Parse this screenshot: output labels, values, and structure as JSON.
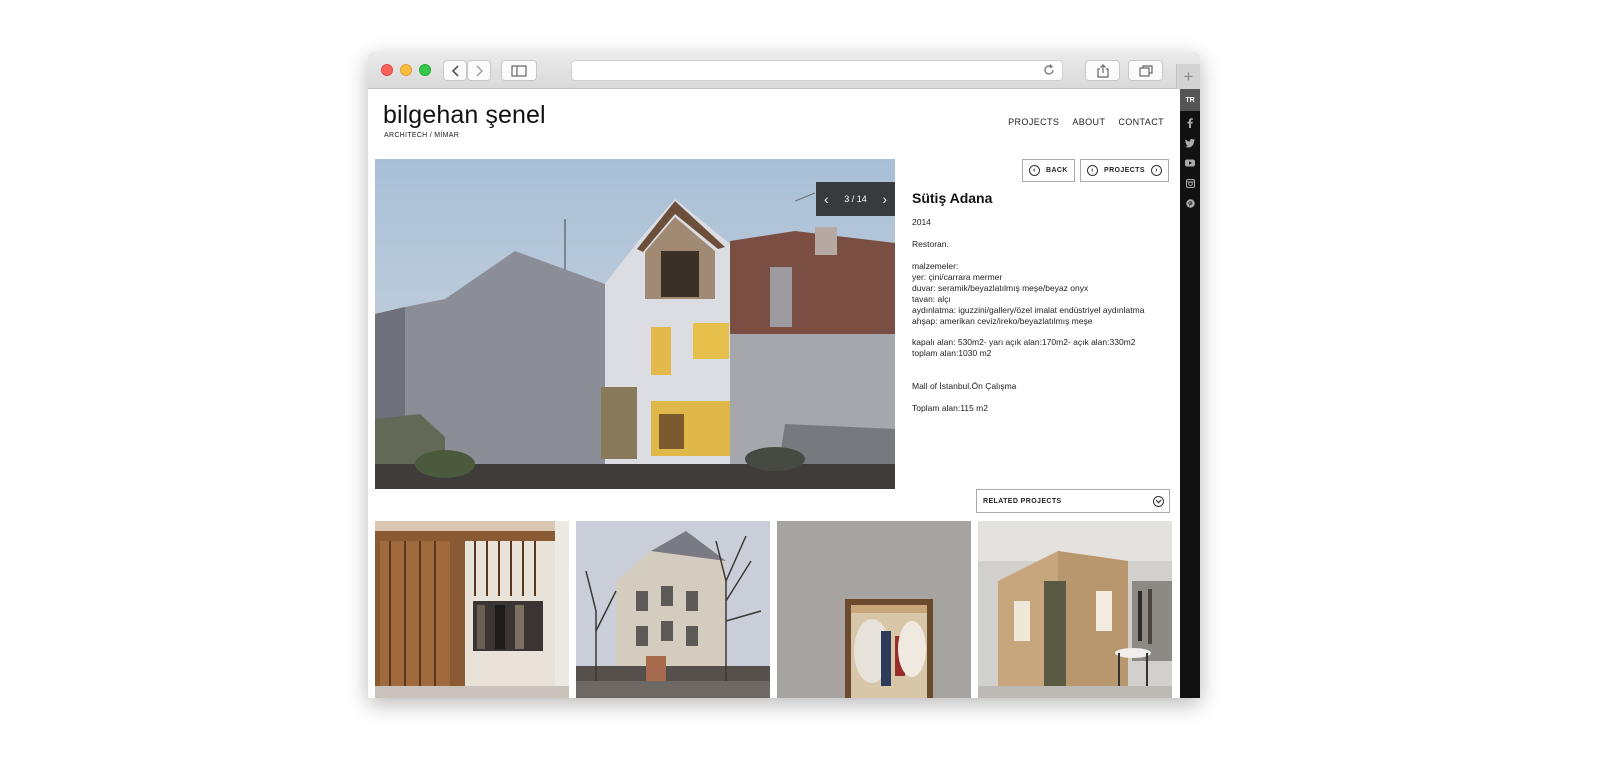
{
  "site": {
    "logo": "bilgehan şenel",
    "tagline": "ARCHITECH / MİMAR"
  },
  "nav": {
    "items": [
      "PROJECTS",
      "ABOUT",
      "CONTACT"
    ]
  },
  "sidebar": {
    "lang": "TR",
    "icons": [
      "facebook-icon",
      "twitter-icon",
      "youtube-icon",
      "instagram-icon",
      "pinterest-icon"
    ]
  },
  "gallery": {
    "counter": "3 / 14"
  },
  "buttons": {
    "back": "BACK",
    "projects": "PROJECTS"
  },
  "project": {
    "title": "Sütiş Adana",
    "year": "2014",
    "type": "Restoran.",
    "materials": [
      "malzemeler:",
      "yer: çini/carrara mermer",
      "duvar: seramik/beyazlatılmış meşe/beyaz onyx",
      "tavan: alçı",
      "aydınlatma: iguzzini/gallery/özel imalat endüstriyel aydınlatma",
      "ahşap: amerikan ceviz/ireko/beyazlatılmış meşe"
    ],
    "area": [
      "kapalı alan: 530m2- yarı açık alan:170m2- açık alan:330m2",
      "toplam alan:1030 m2"
    ],
    "note1": "Mall of İstanbul.Ön Çalışma",
    "note2": "Toplam alan:115 m2"
  },
  "related": {
    "label": "RELATED PROJECTS"
  },
  "colors": {
    "sidebar": "#111111",
    "text": "#222222"
  }
}
